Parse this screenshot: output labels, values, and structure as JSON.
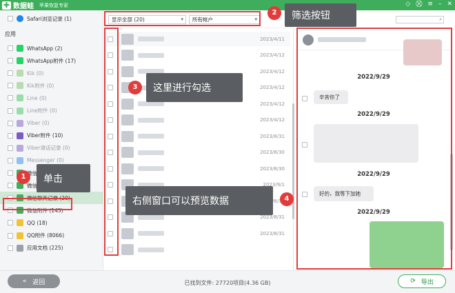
{
  "titlebar": {
    "logo": "数据蛙",
    "subtitle": "苹果恢复专家"
  },
  "sidebar": {
    "safari": {
      "label": "Safari浏览记录 (1)",
      "color": "#1e88e5"
    },
    "section_apps": "应用",
    "items": [
      {
        "label": "WhatsApp (2)",
        "color": "#25d366",
        "dim": false
      },
      {
        "label": "WhatsApp附件 (17)",
        "color": "#25d366",
        "dim": false
      },
      {
        "label": "Kik (0)",
        "color": "#7cc36a",
        "dim": true
      },
      {
        "label": "Kik附件 (0)",
        "color": "#7cc36a",
        "dim": true
      },
      {
        "label": "Line (0)",
        "color": "#3ec85b",
        "dim": true
      },
      {
        "label": "Line附件 (0)",
        "color": "#3ec85b",
        "dim": true
      },
      {
        "label": "Viber (0)",
        "color": "#7b5cc4",
        "dim": true
      },
      {
        "label": "Viber附件 (10)",
        "color": "#7b5cc4",
        "dim": false
      },
      {
        "label": "Viber通话记录 (0)",
        "color": "#7b5cc4",
        "dim": true
      },
      {
        "label": "Messenger (0)",
        "color": "#2d8ef0",
        "dim": true
      },
      {
        "label": "微信",
        "color": "#3fae5c",
        "dim": false
      },
      {
        "label": "微信通讯录 (2260)",
        "color": "#3fae5c",
        "dim": false
      },
      {
        "label": "微信聊天记录 (20)",
        "color": "#3fae5c",
        "dim": false
      },
      {
        "label": "微信附件 (145)",
        "color": "#3fae5c",
        "dim": false
      },
      {
        "label": "QQ (18)",
        "color": "#f1c232",
        "dim": false
      },
      {
        "label": "QQ附件 (8066)",
        "color": "#f1c232",
        "dim": false
      },
      {
        "label": "应用文档 (225)",
        "color": "#9aa0a8",
        "dim": false
      }
    ]
  },
  "filters": {
    "show": "显示全部 (20)",
    "account": "所有帐户"
  },
  "list": {
    "dates": [
      "2023/4/11",
      "2023/4/12",
      "2023/4/12",
      "2023/4/12",
      "2023/4/12",
      "2023/4/12",
      "2023/8/31",
      "2023/8/30",
      "2023/8/30",
      "2023/9/1",
      "2023/8/31",
      "2023/8/31",
      "2023/8/31",
      ""
    ]
  },
  "preview": {
    "date1": "2022/9/29",
    "date2": "2022/9/29",
    "date3": "2022/9/29",
    "date4": "2022/9/29",
    "msg1": "辛苦你了",
    "msg2": "好的，我等下加她"
  },
  "footer": {
    "back": "返回",
    "status": "已找到文件: 27720项目(4.36 GB)",
    "export": "导出"
  },
  "annotations": {
    "c1": "单击",
    "c2": "筛选按钮",
    "c3": "这里进行勾选",
    "c4": "右侧窗口可以预览数据",
    "n1": "1",
    "n2": "2",
    "n3": "3",
    "n4": "4"
  },
  "colors": {
    "brand": "#3fae5c",
    "annotation": "#e23b3b",
    "callout": "#5a5d61"
  }
}
